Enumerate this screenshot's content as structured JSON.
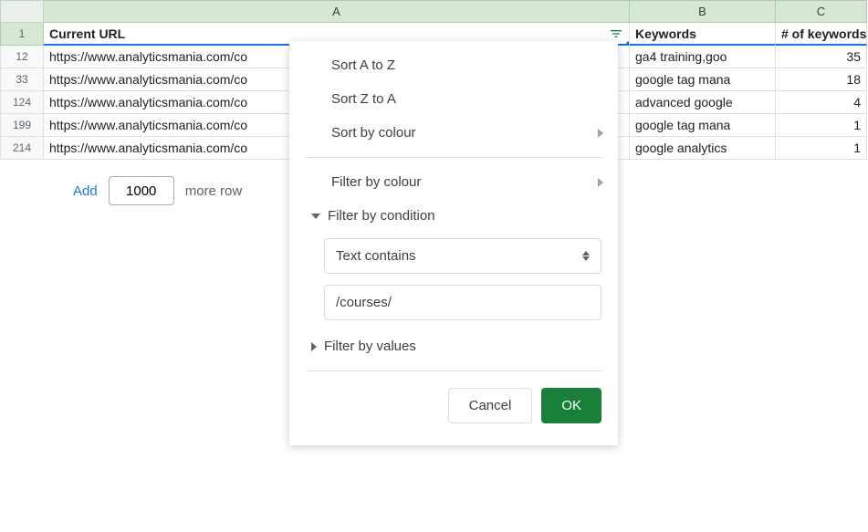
{
  "columns": {
    "a": "A",
    "b": "B",
    "c": "C"
  },
  "headers": {
    "a": "Current URL",
    "b": "Keywords",
    "c": "# of keywords"
  },
  "rows": [
    {
      "num": "1"
    },
    {
      "num": "12",
      "a": "https://www.analyticsmania.com/co",
      "b": "ga4 training,goo",
      "c": "35"
    },
    {
      "num": "33",
      "a": "https://www.analyticsmania.com/co",
      "b": "google tag mana",
      "c": "18"
    },
    {
      "num": "124",
      "a": "https://www.analyticsmania.com/co",
      "b": "advanced google",
      "c": "4"
    },
    {
      "num": "199",
      "a": "https://www.analyticsmania.com/co",
      "b": "google tag mana",
      "c": "1"
    },
    {
      "num": "214",
      "a": "https://www.analyticsmania.com/co",
      "b": "google analytics",
      "c": "1"
    }
  ],
  "addrows": {
    "link": "Add",
    "value": "1000",
    "text": "more row"
  },
  "popup": {
    "sort_az": "Sort A to Z",
    "sort_za": "Sort Z to A",
    "sort_colour": "Sort by colour",
    "filter_colour": "Filter by colour",
    "filter_condition": "Filter by condition",
    "condition_type": "Text contains",
    "condition_value": "/courses/",
    "filter_values": "Filter by values",
    "cancel": "Cancel",
    "ok": "OK"
  }
}
